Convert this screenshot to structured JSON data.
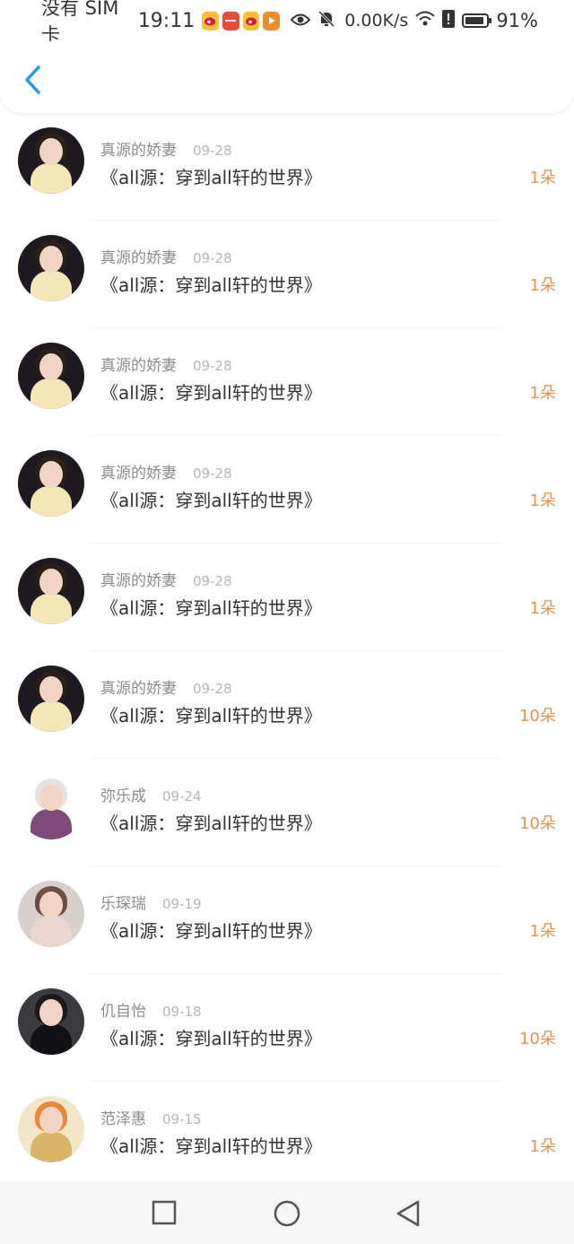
{
  "status_bar": {
    "carrier": "没有 SIM 卡",
    "time": "19:11",
    "speed": "0.00K/s",
    "battery_pct": "91%",
    "battery_level": 0.91,
    "icons": [
      "weibo-icon",
      "huawei-app-icon",
      "weibo-icon",
      "video-app-icon",
      "eye-icon",
      "bell-off-icon",
      "wifi-icon",
      "alert-icon",
      "battery-icon"
    ]
  },
  "header": {
    "back_icon": "chevron-left-icon",
    "accent_color": "#2a9ae8"
  },
  "records": [
    {
      "name": "真源的娇妻",
      "date": "09-28",
      "work": "《all源：穿到all轩的世界》",
      "amount": "1朵",
      "avatar": "avatar-girl-dark"
    },
    {
      "name": "真源的娇妻",
      "date": "09-28",
      "work": "《all源：穿到all轩的世界》",
      "amount": "1朵",
      "avatar": "avatar-girl-dark"
    },
    {
      "name": "真源的娇妻",
      "date": "09-28",
      "work": "《all源：穿到all轩的世界》",
      "amount": "1朵",
      "avatar": "avatar-girl-dark"
    },
    {
      "name": "真源的娇妻",
      "date": "09-28",
      "work": "《all源：穿到all轩的世界》",
      "amount": "1朵",
      "avatar": "avatar-girl-dark"
    },
    {
      "name": "真源的娇妻",
      "date": "09-28",
      "work": "《all源：穿到all轩的世界》",
      "amount": "1朵",
      "avatar": "avatar-girl-dark"
    },
    {
      "name": "真源的娇妻",
      "date": "09-28",
      "work": "《all源：穿到all轩的世界》",
      "amount": "10朵",
      "avatar": "avatar-girl-dark"
    },
    {
      "name": "弥乐成",
      "date": "09-24",
      "work": "《all源：穿到all轩的世界》",
      "amount": "10朵",
      "avatar": "avatar-girl-white"
    },
    {
      "name": "乐琛瑞",
      "date": "09-19",
      "work": "《all源：穿到all轩的世界》",
      "amount": "1朵",
      "avatar": "avatar-girl-pink"
    },
    {
      "name": "仉自怡",
      "date": "09-18",
      "work": "《all源：穿到all轩的世界》",
      "amount": "10朵",
      "avatar": "avatar-girl-black"
    },
    {
      "name": "范泽惠",
      "date": "09-15",
      "work": "《all源：穿到all轩的世界》",
      "amount": "1朵",
      "avatar": "avatar-shrimp-food"
    }
  ],
  "colors": {
    "amount": "#e8914a",
    "name": "#8c8c8c",
    "date": "#b5b5b5",
    "title": "#333333"
  },
  "nav_bar": {
    "icons": [
      "square-recent-icon",
      "circle-home-icon",
      "triangle-back-icon"
    ]
  }
}
